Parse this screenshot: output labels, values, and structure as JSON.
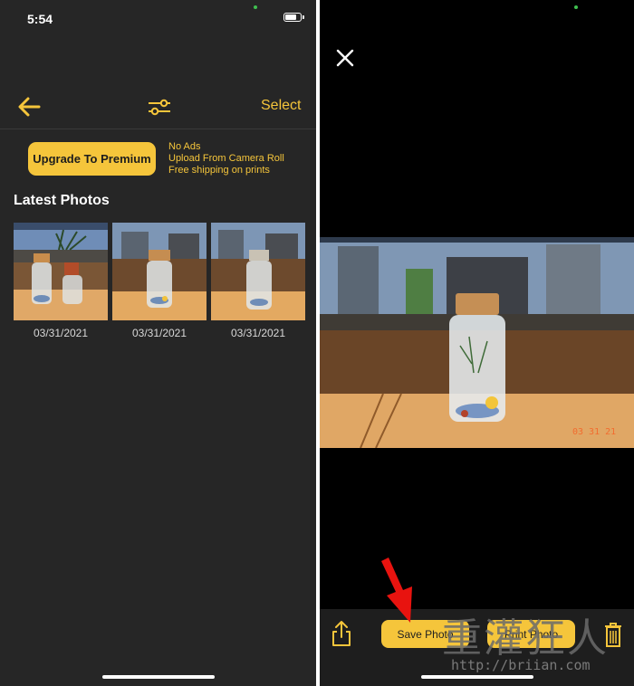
{
  "colors": {
    "accent": "#f5c53b",
    "left_bg": "#262626",
    "right_bg": "#000000",
    "arrow": "#e8130f"
  },
  "left_screen": {
    "status": {
      "time": "5:54"
    },
    "nav": {
      "back_icon": "arrow-left-icon",
      "filter_icon": "sliders-icon",
      "select_label": "Select"
    },
    "premium": {
      "button_label": "Upgrade To Premium",
      "perks": [
        "No Ads",
        "Upload From Camera Roll",
        "Free shipping on prints"
      ]
    },
    "section_title": "Latest Photos",
    "photos": [
      {
        "date": "03/31/2021"
      },
      {
        "date": "03/31/2021"
      },
      {
        "date": "03/31/2021"
      }
    ]
  },
  "right_screen": {
    "close_icon": "close-icon",
    "photo_stamp": "03 31 21",
    "toolbar": {
      "share_icon": "share-icon",
      "save_label": "Save Photo",
      "print_label": "Print Photo",
      "trash_icon": "trash-icon"
    },
    "watermark": {
      "glyphs": "重灌狂人",
      "url": "http://briian.com"
    }
  }
}
